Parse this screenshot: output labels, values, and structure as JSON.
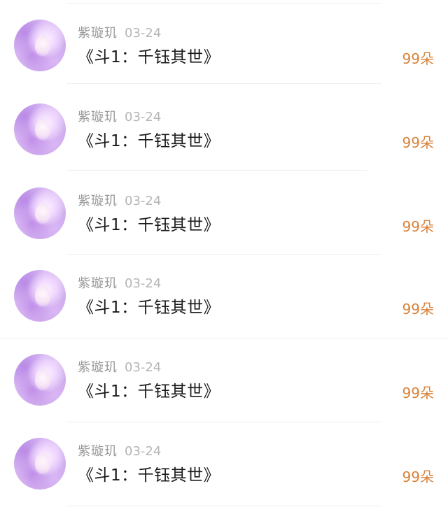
{
  "comments": [
    {
      "username": "紫璇玑",
      "date": "03-24",
      "text": "《斗1：千钰其世》",
      "gift": "99朵",
      "avatar_icon": "user-avatar"
    },
    {
      "username": "紫璇玑",
      "date": "03-24",
      "text": "《斗1：千钰其世》",
      "gift": "99朵",
      "avatar_icon": "user-avatar"
    },
    {
      "username": "紫璇玑",
      "date": "03-24",
      "text": "《斗1：千钰其世》",
      "gift": "99朵",
      "avatar_icon": "user-avatar"
    },
    {
      "username": "紫璇玑",
      "date": "03-24",
      "text": "《斗1：千钰其世》",
      "gift": "99朵",
      "avatar_icon": "user-avatar"
    },
    {
      "username": "紫璇玑",
      "date": "03-24",
      "text": "《斗1：千钰其世》",
      "gift": "99朵",
      "avatar_icon": "user-avatar"
    },
    {
      "username": "紫璇玑",
      "date": "03-24",
      "text": "《斗1：千钰其世》",
      "gift": "99朵",
      "avatar_icon": "user-avatar"
    }
  ],
  "colors": {
    "gift_accent": "#d9823a",
    "username": "#999999",
    "date": "#b5b5b5",
    "title": "#1a1a1a"
  }
}
